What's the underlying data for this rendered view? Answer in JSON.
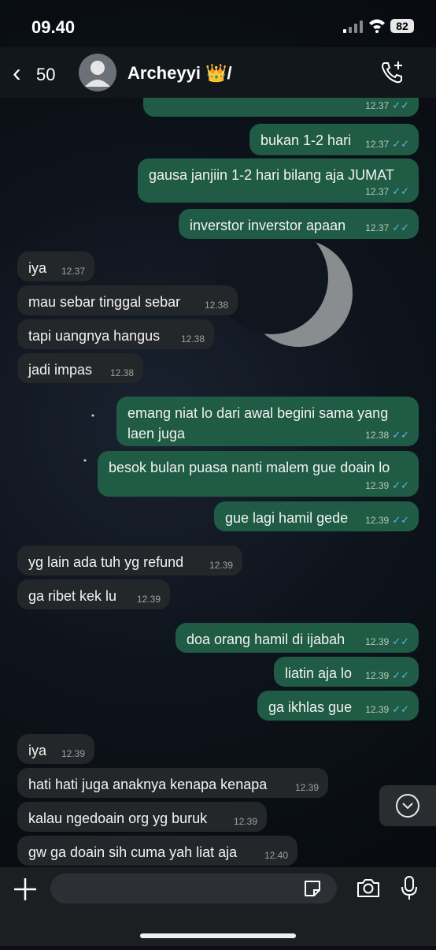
{
  "status": {
    "time": "09.40",
    "battery": "82"
  },
  "header": {
    "back_count": "50",
    "contact_name": "Archeyyi 👑/"
  },
  "messages": [
    {
      "dir": "out",
      "text": "",
      "time": "12.37"
    },
    {
      "dir": "out",
      "text": "bukan 1-2 hari",
      "time": "12.37"
    },
    {
      "dir": "out",
      "text": "gausa janjiin 1-2 hari bilang aja JUMAT",
      "time": "12.37"
    },
    {
      "dir": "out",
      "text": "inverstor inverstor apaan",
      "time": "12.37"
    },
    {
      "dir": "in",
      "text": "iya",
      "time": "12.37"
    },
    {
      "dir": "in",
      "text": "mau sebar tinggal sebar",
      "time": "12.38"
    },
    {
      "dir": "in",
      "text": "tapi uangnya hangus",
      "time": "12.38"
    },
    {
      "dir": "in",
      "text": "jadi impas",
      "time": "12.38"
    },
    {
      "dir": "out",
      "text": "emang niat lo dari awal begini sama yang laen juga",
      "line1": "emang niat lo dari awal begini sama yang",
      "line2": "laen juga",
      "time": "12.38"
    },
    {
      "dir": "out",
      "text": "besok bulan puasa nanti malem gue doain lo",
      "time": "12.39"
    },
    {
      "dir": "out",
      "text": "gue lagi hamil gede",
      "time": "12.39"
    },
    {
      "dir": "in",
      "text": "yg lain ada tuh yg refund",
      "time": "12.39"
    },
    {
      "dir": "in",
      "text": "ga ribet kek lu",
      "time": "12.39"
    },
    {
      "dir": "out",
      "text": "doa orang hamil di ijabah",
      "time": "12.39"
    },
    {
      "dir": "out",
      "text": "liatin aja lo",
      "time": "12.39"
    },
    {
      "dir": "out",
      "text": "ga ikhlas gue",
      "time": "12.39"
    },
    {
      "dir": "in",
      "text": "iya",
      "time": "12.39"
    },
    {
      "dir": "in",
      "text": "hati hati juga anaknya kenapa kenapa",
      "time": "12.39"
    },
    {
      "dir": "in",
      "text": "kalau ngedoain org yg buruk",
      "time": "12.39"
    },
    {
      "dir": "in",
      "text": "gw ga doain sih cuma yah liat aja",
      "time": "12.40"
    }
  ],
  "tick_glyph": "✓✓",
  "colors": {
    "outgoing": "#1f5b45",
    "incoming": "#24272a",
    "read_tick": "#5bb6f0"
  }
}
